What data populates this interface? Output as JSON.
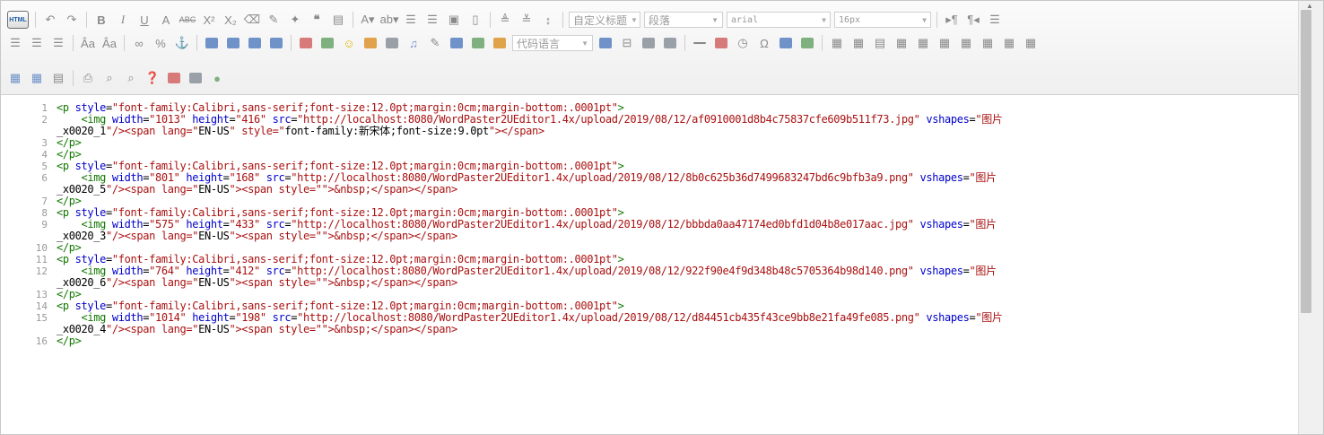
{
  "toolbar": {
    "source_button_label": "HTML",
    "combo_title_style": "自定义标题",
    "combo_paragraph": "段落",
    "combo_font_family": "arial",
    "combo_font_size": "16px",
    "combo_code_language": "代码语言"
  },
  "editor": {
    "line_numbers": [
      "1",
      "2",
      "3",
      "4",
      "5",
      "6",
      "7",
      "8",
      "9",
      "10",
      "11",
      "12",
      "13",
      "14",
      "15",
      "16"
    ],
    "code_lines": [
      {
        "ln": "1",
        "t": "<p style=\"font-family:Calibri,sans-serif;font-size:12.0pt;margin:0cm;margin-bottom:.0001pt\">"
      },
      {
        "ln": "2",
        "t": "    <img width=\"1013\" height=\"416\" src=\"http://localhost:8080/WordPaster2UEditor1.4x/upload/2019/08/12/af0910001d8b4c75837cfe609b511f73.jpg\" vshapes=\"图片"
      },
      {
        "ln": "",
        "t": "_x0020_1\"/><span lang=\"EN-US\" style=\"font-family:新宋体;font-size:9.0pt\"></span>"
      },
      {
        "ln": "3",
        "t": "</p>"
      },
      {
        "ln": "4",
        "t": "</p>"
      },
      {
        "ln": "5",
        "t": "<p style=\"font-family:Calibri,sans-serif;font-size:12.0pt;margin:0cm;margin-bottom:.0001pt\">"
      },
      {
        "ln": "6",
        "t": "    <img width=\"801\" height=\"168\" src=\"http://localhost:8080/WordPaster2UEditor1.4x/upload/2019/08/12/8b0c625b36d7499683247bd6c9bfb3a9.png\" vshapes=\"图片"
      },
      {
        "ln": "",
        "t": "_x0020_5\"/><span lang=\"EN-US\"><span style=\"\">&nbsp;</span></span>"
      },
      {
        "ln": "7",
        "t": "</p>"
      },
      {
        "ln": "8",
        "t": "<p style=\"font-family:Calibri,sans-serif;font-size:12.0pt;margin:0cm;margin-bottom:.0001pt\">"
      },
      {
        "ln": "9",
        "t": "    <img width=\"575\" height=\"433\" src=\"http://localhost:8080/WordPaster2UEditor1.4x/upload/2019/08/12/bbbda0aa47174ed0bfd1d04b8e017aac.jpg\" vshapes=\"图片"
      },
      {
        "ln": "",
        "t": "_x0020_3\"/><span lang=\"EN-US\"><span style=\"\">&nbsp;</span></span>"
      },
      {
        "ln": "10",
        "t": "</p>"
      },
      {
        "ln": "11",
        "t": "<p style=\"font-family:Calibri,sans-serif;font-size:12.0pt;margin:0cm;margin-bottom:.0001pt\">"
      },
      {
        "ln": "12",
        "t": "    <img width=\"764\" height=\"412\" src=\"http://localhost:8080/WordPaster2UEditor1.4x/upload/2019/08/12/922f90e4f9d348b48c5705364b98d140.png\" vshapes=\"图片"
      },
      {
        "ln": "",
        "t": "_x0020_6\"/><span lang=\"EN-US\"><span style=\"\">&nbsp;</span></span>"
      },
      {
        "ln": "13",
        "t": "</p>"
      },
      {
        "ln": "14",
        "t": "<p style=\"font-family:Calibri,sans-serif;font-size:12.0pt;margin:0cm;margin-bottom:.0001pt\">"
      },
      {
        "ln": "15",
        "t": "    <img width=\"1014\" height=\"198\" src=\"http://localhost:8080/WordPaster2UEditor1.4x/upload/2019/08/12/d84451cb435f43ce9bb8e21fa49fe085.png\" vshapes=\"图片"
      },
      {
        "ln": "",
        "t": "_x0020_4\"/><span lang=\"EN-US\"><span style=\"\">&nbsp;</span></span>"
      },
      {
        "ln": "16",
        "t": "</p>"
      }
    ]
  },
  "colors": {
    "tag": "#117700",
    "attr": "#0000cc",
    "string": "#aa1111"
  }
}
